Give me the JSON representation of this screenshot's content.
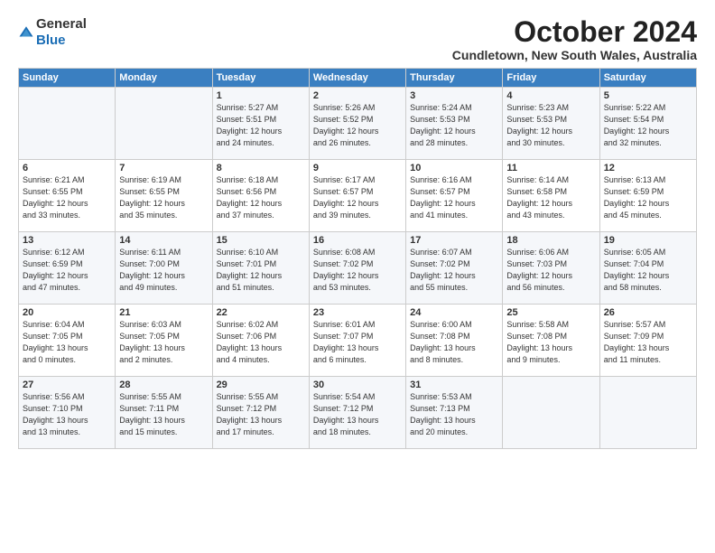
{
  "logo": {
    "general": "General",
    "blue": "Blue"
  },
  "title": "October 2024",
  "location": "Cundletown, New South Wales, Australia",
  "days_header": [
    "Sunday",
    "Monday",
    "Tuesday",
    "Wednesday",
    "Thursday",
    "Friday",
    "Saturday"
  ],
  "weeks": [
    [
      {
        "day": "",
        "info": ""
      },
      {
        "day": "",
        "info": ""
      },
      {
        "day": "1",
        "info": "Sunrise: 5:27 AM\nSunset: 5:51 PM\nDaylight: 12 hours\nand 24 minutes."
      },
      {
        "day": "2",
        "info": "Sunrise: 5:26 AM\nSunset: 5:52 PM\nDaylight: 12 hours\nand 26 minutes."
      },
      {
        "day": "3",
        "info": "Sunrise: 5:24 AM\nSunset: 5:53 PM\nDaylight: 12 hours\nand 28 minutes."
      },
      {
        "day": "4",
        "info": "Sunrise: 5:23 AM\nSunset: 5:53 PM\nDaylight: 12 hours\nand 30 minutes."
      },
      {
        "day": "5",
        "info": "Sunrise: 5:22 AM\nSunset: 5:54 PM\nDaylight: 12 hours\nand 32 minutes."
      }
    ],
    [
      {
        "day": "6",
        "info": "Sunrise: 6:21 AM\nSunset: 6:55 PM\nDaylight: 12 hours\nand 33 minutes."
      },
      {
        "day": "7",
        "info": "Sunrise: 6:19 AM\nSunset: 6:55 PM\nDaylight: 12 hours\nand 35 minutes."
      },
      {
        "day": "8",
        "info": "Sunrise: 6:18 AM\nSunset: 6:56 PM\nDaylight: 12 hours\nand 37 minutes."
      },
      {
        "day": "9",
        "info": "Sunrise: 6:17 AM\nSunset: 6:57 PM\nDaylight: 12 hours\nand 39 minutes."
      },
      {
        "day": "10",
        "info": "Sunrise: 6:16 AM\nSunset: 6:57 PM\nDaylight: 12 hours\nand 41 minutes."
      },
      {
        "day": "11",
        "info": "Sunrise: 6:14 AM\nSunset: 6:58 PM\nDaylight: 12 hours\nand 43 minutes."
      },
      {
        "day": "12",
        "info": "Sunrise: 6:13 AM\nSunset: 6:59 PM\nDaylight: 12 hours\nand 45 minutes."
      }
    ],
    [
      {
        "day": "13",
        "info": "Sunrise: 6:12 AM\nSunset: 6:59 PM\nDaylight: 12 hours\nand 47 minutes."
      },
      {
        "day": "14",
        "info": "Sunrise: 6:11 AM\nSunset: 7:00 PM\nDaylight: 12 hours\nand 49 minutes."
      },
      {
        "day": "15",
        "info": "Sunrise: 6:10 AM\nSunset: 7:01 PM\nDaylight: 12 hours\nand 51 minutes."
      },
      {
        "day": "16",
        "info": "Sunrise: 6:08 AM\nSunset: 7:02 PM\nDaylight: 12 hours\nand 53 minutes."
      },
      {
        "day": "17",
        "info": "Sunrise: 6:07 AM\nSunset: 7:02 PM\nDaylight: 12 hours\nand 55 minutes."
      },
      {
        "day": "18",
        "info": "Sunrise: 6:06 AM\nSunset: 7:03 PM\nDaylight: 12 hours\nand 56 minutes."
      },
      {
        "day": "19",
        "info": "Sunrise: 6:05 AM\nSunset: 7:04 PM\nDaylight: 12 hours\nand 58 minutes."
      }
    ],
    [
      {
        "day": "20",
        "info": "Sunrise: 6:04 AM\nSunset: 7:05 PM\nDaylight: 13 hours\nand 0 minutes."
      },
      {
        "day": "21",
        "info": "Sunrise: 6:03 AM\nSunset: 7:05 PM\nDaylight: 13 hours\nand 2 minutes."
      },
      {
        "day": "22",
        "info": "Sunrise: 6:02 AM\nSunset: 7:06 PM\nDaylight: 13 hours\nand 4 minutes."
      },
      {
        "day": "23",
        "info": "Sunrise: 6:01 AM\nSunset: 7:07 PM\nDaylight: 13 hours\nand 6 minutes."
      },
      {
        "day": "24",
        "info": "Sunrise: 6:00 AM\nSunset: 7:08 PM\nDaylight: 13 hours\nand 8 minutes."
      },
      {
        "day": "25",
        "info": "Sunrise: 5:58 AM\nSunset: 7:08 PM\nDaylight: 13 hours\nand 9 minutes."
      },
      {
        "day": "26",
        "info": "Sunrise: 5:57 AM\nSunset: 7:09 PM\nDaylight: 13 hours\nand 11 minutes."
      }
    ],
    [
      {
        "day": "27",
        "info": "Sunrise: 5:56 AM\nSunset: 7:10 PM\nDaylight: 13 hours\nand 13 minutes."
      },
      {
        "day": "28",
        "info": "Sunrise: 5:55 AM\nSunset: 7:11 PM\nDaylight: 13 hours\nand 15 minutes."
      },
      {
        "day": "29",
        "info": "Sunrise: 5:55 AM\nSunset: 7:12 PM\nDaylight: 13 hours\nand 17 minutes."
      },
      {
        "day": "30",
        "info": "Sunrise: 5:54 AM\nSunset: 7:12 PM\nDaylight: 13 hours\nand 18 minutes."
      },
      {
        "day": "31",
        "info": "Sunrise: 5:53 AM\nSunset: 7:13 PM\nDaylight: 13 hours\nand 20 minutes."
      },
      {
        "day": "",
        "info": ""
      },
      {
        "day": "",
        "info": ""
      }
    ]
  ]
}
